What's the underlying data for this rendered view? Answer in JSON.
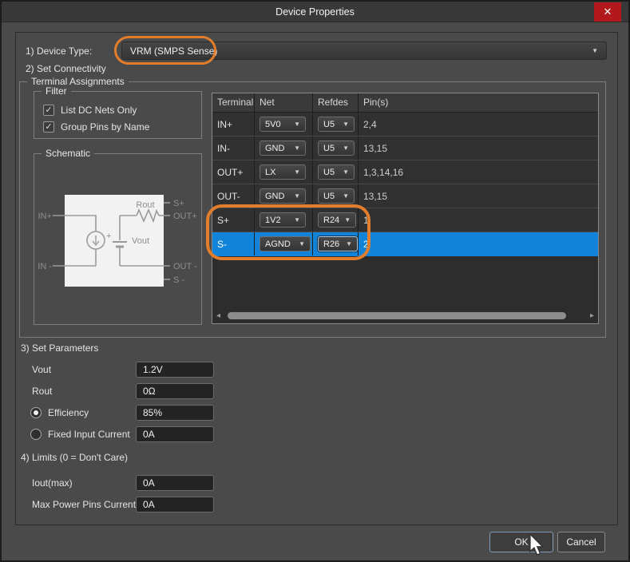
{
  "window": {
    "title": "Device Properties"
  },
  "icons": {
    "close": "✕",
    "chevron_down": "▼",
    "check": "✓",
    "arrow_left": "◂",
    "arrow_right": "▸"
  },
  "device_type": {
    "label": "1) Device Type:",
    "value": "VRM (SMPS Sense)"
  },
  "connectivity": {
    "label": "2) Set Connectivity",
    "group_title": "Terminal Assignments",
    "filter": {
      "title": "Filter",
      "checkboxes": [
        {
          "label": "List DC Nets Only",
          "checked": true
        },
        {
          "label": "Group Pins by Name",
          "checked": true
        }
      ]
    },
    "schematic": {
      "title": "Schematic",
      "pin_in_plus": "IN+",
      "pin_in_minus": "IN -",
      "pin_s_plus": "S+",
      "pin_out_plus": "OUT+",
      "pin_out_minus": "OUT -",
      "pin_s_minus": "S -",
      "rout_label": "Rout",
      "vout_label": "Vout",
      "plus_sign": "+"
    },
    "table": {
      "columns": [
        "Terminal",
        "Net",
        "Refdes",
        "Pin(s)"
      ],
      "rows": [
        {
          "terminal": "IN+",
          "net": "5V0",
          "refdes": "U5",
          "pins": "2,4"
        },
        {
          "terminal": "IN-",
          "net": "GND",
          "refdes": "U5",
          "pins": "13,15"
        },
        {
          "terminal": "OUT+",
          "net": "LX",
          "refdes": "U5",
          "pins": "1,3,14,16"
        },
        {
          "terminal": "OUT-",
          "net": "GND",
          "refdes": "U5",
          "pins": "13,15"
        },
        {
          "terminal": "S+",
          "net": "1V2",
          "refdes": "R24",
          "pins": "1"
        },
        {
          "terminal": "S-",
          "net": "AGND",
          "refdes": "R26",
          "pins": "2"
        }
      ],
      "selected_row": "S-"
    }
  },
  "parameters": {
    "label": "3) Set Parameters",
    "vout": {
      "label": "Vout",
      "value": "1.2V"
    },
    "rout": {
      "label": "Rout",
      "value": "0Ω"
    },
    "efficiency": {
      "label": "Efficiency",
      "value": "85%",
      "selected": true
    },
    "fixed_input": {
      "label": "Fixed Input Current",
      "value": "0A",
      "selected": false
    }
  },
  "limits": {
    "label": "4) Limits (0 = Don't Care)",
    "iout_max": {
      "label": "Iout(max)",
      "value": "0A"
    },
    "max_power_pins": {
      "label": "Max Power Pins Current",
      "value": "0A"
    }
  },
  "buttons": {
    "ok": "OK",
    "cancel": "Cancel"
  },
  "colors": {
    "selection": "#1183d8",
    "annotation": "#e27d2c",
    "close_button": "#b2191c"
  }
}
